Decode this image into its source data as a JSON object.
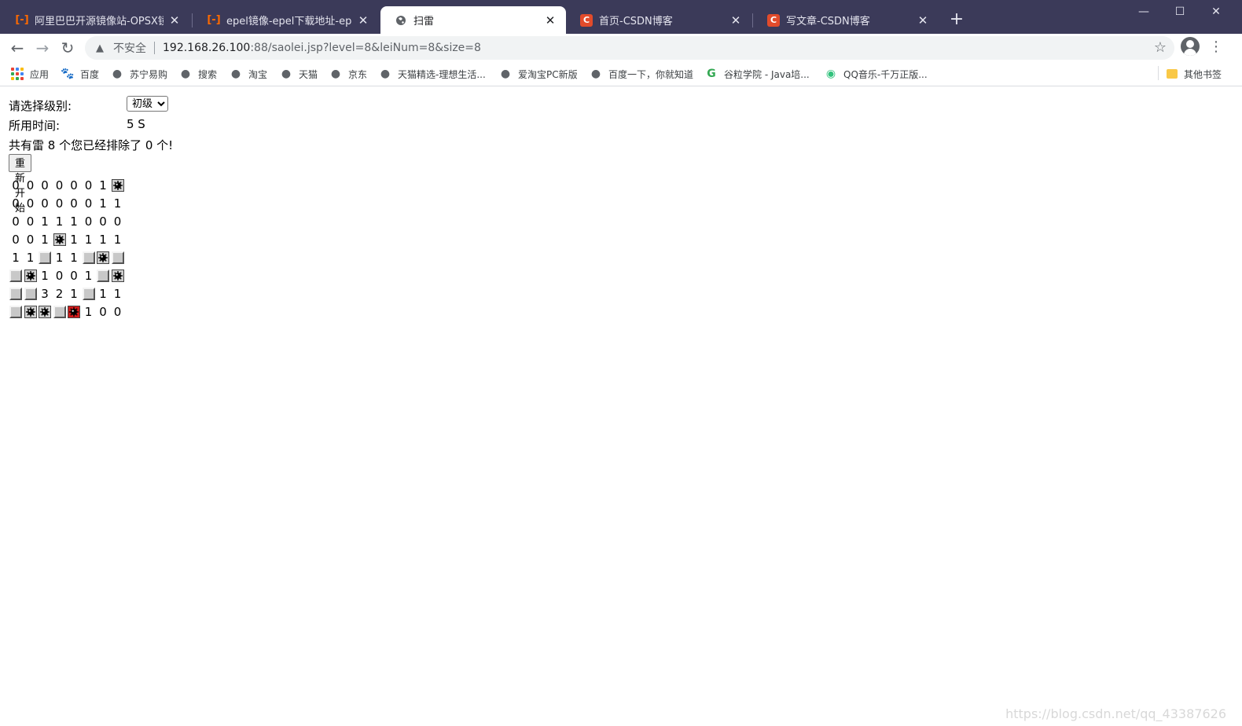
{
  "browser": {
    "tabs": [
      {
        "title": "阿里巴巴开源镜像站-OPSX镜像站",
        "icon": "aliyun-icon",
        "active": false
      },
      {
        "title": "epel镜像-epel下载地址-epel安装",
        "icon": "aliyun-icon",
        "active": false
      },
      {
        "title": "扫雷",
        "icon": "globe-icon",
        "active": true
      },
      {
        "title": "首页-CSDN博客",
        "icon": "csdn-icon",
        "active": false
      },
      {
        "title": "写文章-CSDN博客",
        "icon": "csdn-icon",
        "active": false
      }
    ],
    "address": {
      "security_label": "不安全",
      "host": "192.168.26.100",
      "path": ":88/saolei.jsp?level=8&leiNum=8&size=8"
    },
    "bookmarks": [
      {
        "label": "应用",
        "icon": "apps-icon"
      },
      {
        "label": "百度",
        "icon": "baidu-icon"
      },
      {
        "label": "苏宁易购",
        "icon": "globe-icon"
      },
      {
        "label": "搜索",
        "icon": "globe-icon"
      },
      {
        "label": "淘宝",
        "icon": "globe-icon"
      },
      {
        "label": "天猫",
        "icon": "globe-icon"
      },
      {
        "label": "京东",
        "icon": "globe-icon"
      },
      {
        "label": "天猫精选-理想生活...",
        "icon": "globe-icon"
      },
      {
        "label": "爱淘宝PC新版",
        "icon": "globe-icon"
      },
      {
        "label": "百度一下，你就知道",
        "icon": "globe-icon"
      },
      {
        "label": "谷粒学院 - Java培...",
        "icon": "google-icon"
      },
      {
        "label": "QQ音乐-千万正版...",
        "icon": "qqmusic-icon"
      }
    ],
    "other_bookmarks": "其他书签"
  },
  "game": {
    "level_label": "请选择级别:",
    "level_selected": "初级",
    "time_label": "所用时间:",
    "time_value": "5 S",
    "mine_status": "共有雷 8 个您已经排除了 0 个!",
    "restart_label": "重新开始",
    "board": [
      [
        "0",
        "0",
        "0",
        "0",
        "0",
        "0",
        "1",
        "M"
      ],
      [
        "0",
        "0",
        "0",
        "0",
        "0",
        "0",
        "1",
        "1"
      ],
      [
        "0",
        "0",
        "1",
        "1",
        "1",
        "0",
        "0",
        "0"
      ],
      [
        "0",
        "0",
        "1",
        "M",
        "1",
        "1",
        "1",
        "1"
      ],
      [
        "1",
        "1",
        "H",
        "1",
        "1",
        "H",
        "M",
        "H"
      ],
      [
        "H",
        "M",
        "1",
        "0",
        "0",
        "1",
        "H",
        "M"
      ],
      [
        "H",
        "H",
        "3",
        "2",
        "1",
        "H",
        "1",
        "1"
      ],
      [
        "H",
        "M",
        "M",
        "H",
        "X",
        "1",
        "0",
        "0"
      ]
    ],
    "board_legend": {
      "M": "mine",
      "X": "exploded-mine",
      "H": "hidden"
    }
  },
  "watermark": "https://blog.csdn.net/qq_43387626"
}
